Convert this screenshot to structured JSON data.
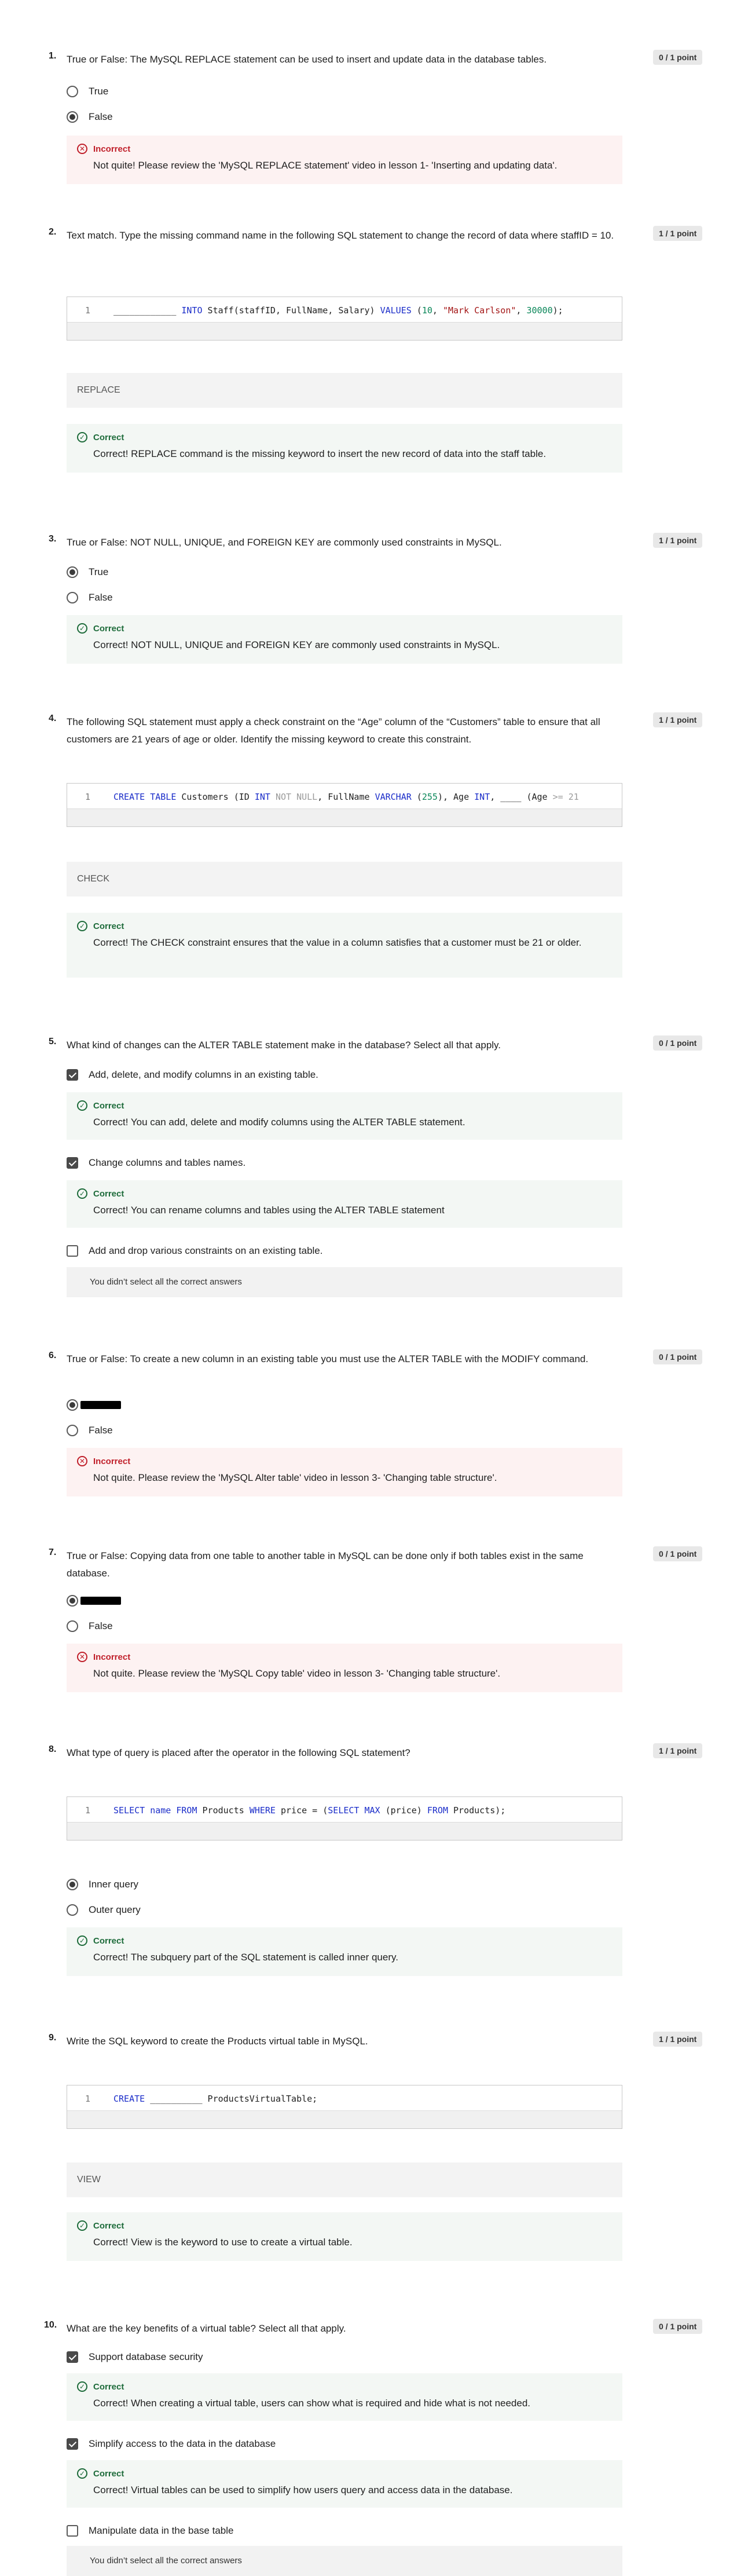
{
  "questions": [
    {
      "num": "1.",
      "text": "True or False: The MySQL REPLACE statement can be used to insert and update data in the database tables.",
      "points": "0 / 1 point",
      "options": [
        {
          "label": "True",
          "checked": false
        },
        {
          "label": "False",
          "checked": true
        }
      ],
      "feedback": {
        "status": "Incorrect",
        "text": "Not quite! Please review the 'MySQL REPLACE statement' video in lesson 1- 'Inserting and updating data'."
      }
    },
    {
      "num": "2.",
      "text": "Text match. Type the missing command name in the following SQL statement to change the record of data where staffID = 10.",
      "points": "1 / 1 point",
      "code": {
        "line_number": "1",
        "blank": "____________",
        "parts": [
          " INTO",
          " Staff(staffID, FullName, Salary) ",
          "VALUES",
          " (",
          "10",
          ", ",
          "\"Mark Carlson\"",
          ", ",
          "30000",
          ");"
        ]
      },
      "answer": "REPLACE",
      "feedback": {
        "status": "Correct",
        "text": "Correct! REPLACE command is the missing keyword to insert the new record of data into the staff table."
      }
    },
    {
      "num": "3.",
      "text": "True or False: NOT NULL, UNIQUE, and FOREIGN KEY are commonly used constraints in MySQL.",
      "points": "1 / 1 point",
      "options": [
        {
          "label": "True",
          "checked": true
        },
        {
          "label": "False",
          "checked": false
        }
      ],
      "feedback": {
        "status": "Correct",
        "text": "Correct! NOT NULL, UNIQUE and FOREIGN KEY are commonly used constraints in MySQL."
      }
    },
    {
      "num": "4.",
      "text": "The following SQL statement must apply a check constraint on the “Age” column of the “Customers” table to ensure that all customers are 21 years of age or older. Identify the missing keyword to create this constraint.",
      "points": "1 / 1 point",
      "code": {
        "line_number": "1",
        "parts": [
          "CREATE TABLE",
          " Customers (ID ",
          "INT",
          " ",
          "NOT NULL",
          ", FullName ",
          "VARCHAR",
          " (",
          "255",
          "), Age ",
          "INT",
          ", ____ (Age ",
          ">= 21"
        ]
      },
      "answer": "CHECK",
      "feedback": {
        "status": "Correct",
        "text": "Correct! The CHECK constraint ensures that the value in a column satisfies that a customer must be 21 or older."
      }
    },
    {
      "num": "5.",
      "text": "What kind of changes can the ALTER TABLE statement make in the database? Select all that apply.",
      "points": "0 / 1 point",
      "options": [
        {
          "label": "Add, delete, and modify columns in an existing table.",
          "checked": true,
          "feedback": {
            "status": "Correct",
            "text": "Correct! You can add, delete and modify columns using the ALTER TABLE statement."
          }
        },
        {
          "label": "Change columns and tables names.",
          "checked": true,
          "feedback": {
            "status": "Correct",
            "text": "Correct! You can rename columns and tables using the ALTER TABLE statement"
          }
        },
        {
          "label": "Add and drop various constraints on an existing table.",
          "checked": false
        }
      ],
      "note": "You didn’t select all the correct answers"
    },
    {
      "num": "6.",
      "text": "True or False: To create a new column in an existing table you must use the ALTER TABLE with the MODIFY command.",
      "points": "0 / 1 point",
      "options": [
        {
          "label": "",
          "checked": true,
          "redacted": true
        },
        {
          "label": "False",
          "checked": false
        }
      ],
      "feedback": {
        "status": "Incorrect",
        "text": "Not quite. Please review the 'MySQL Alter table' video in lesson 3- 'Changing table structure'."
      }
    },
    {
      "num": "7.",
      "text": "True or False: Copying data from one table to another table in MySQL can be done only if both tables exist in the same database.",
      "points": "0 / 1 point",
      "options": [
        {
          "label": "",
          "checked": true,
          "redacted": true
        },
        {
          "label": "False",
          "checked": false
        }
      ],
      "feedback": {
        "status": "Incorrect",
        "text": "Not quite. Please review the 'MySQL Copy table' video in lesson 3- 'Changing table structure'."
      }
    },
    {
      "num": "8.",
      "text": "What type of query is placed after the operator in the following SQL statement?",
      "points": "1 / 1 point",
      "code": {
        "line_number": "1",
        "parts": [
          "SELECT name FROM",
          " Products ",
          "WHERE",
          " price = (",
          "SELECT MAX",
          " (price) ",
          "FROM",
          " Products);"
        ]
      },
      "options": [
        {
          "label": "Inner query",
          "checked": true
        },
        {
          "label": "Outer query",
          "checked": false
        }
      ],
      "feedback": {
        "status": "Correct",
        "text": "Correct! The subquery part of the SQL statement is called inner query."
      }
    },
    {
      "num": "9.",
      "text": "Write the SQL keyword to create the Products virtual table in MySQL.",
      "points": "1 / 1 point",
      "code": {
        "line_number": "1",
        "parts": [
          "CREATE",
          " __________ ProductsVirtualTable;"
        ]
      },
      "answer": "VIEW",
      "feedback": {
        "status": "Correct",
        "text": "Correct! View is the keyword to use to create a virtual table."
      }
    },
    {
      "num": "10.",
      "text": "What are the key benefits of a virtual table? Select all that apply.",
      "points": "0 / 1 point",
      "options": [
        {
          "label": "Support database security",
          "checked": true,
          "feedback": {
            "status": "Correct",
            "text": "Correct! When creating a virtual table, users can show what is required and hide what is not needed."
          }
        },
        {
          "label": "Simplify access to the data in the database",
          "checked": true,
          "feedback": {
            "status": "Correct",
            "text": "Correct! Virtual tables can be used to simplify how users query and access data in the database."
          }
        },
        {
          "label": "Manipulate data in the base table",
          "checked": false
        }
      ],
      "note": "You didn’t select all the correct answers"
    }
  ],
  "colors": {
    "correct": "#1d6b3a",
    "incorrect": "#c01f2a",
    "keyword": "#1a2cc9",
    "string": "#a31515",
    "number": "#098658"
  },
  "icons": {
    "correct": "check-circle-icon",
    "incorrect": "x-circle-icon"
  }
}
